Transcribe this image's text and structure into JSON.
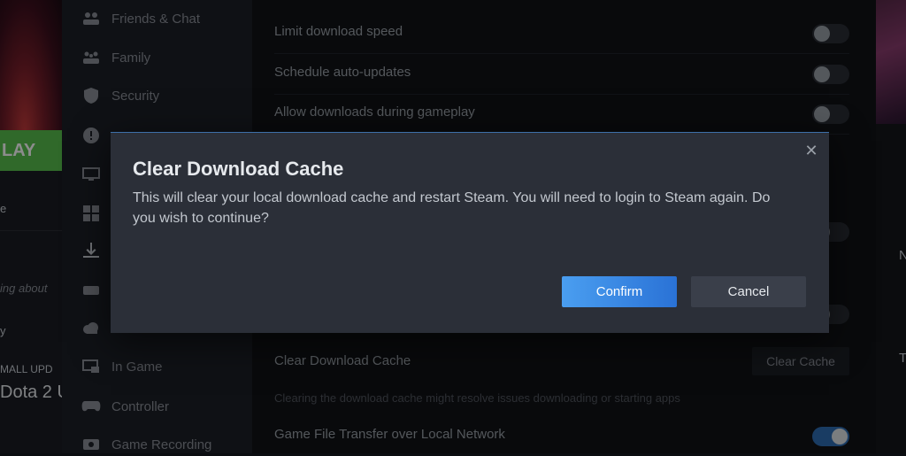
{
  "library": {
    "play_label": "LAY",
    "line1": "e",
    "news_snippet": "ing about",
    "line3": "y",
    "update_label": "MALL UPD",
    "game_title": "Dota 2 U"
  },
  "sidebar": {
    "items": [
      {
        "label": "Friends & Chat",
        "icon": "friends-icon"
      },
      {
        "label": "Family",
        "icon": "family-icon"
      },
      {
        "label": "Security",
        "icon": "shield-icon"
      },
      {
        "label": "",
        "icon": "info-icon"
      },
      {
        "label": "",
        "icon": "monitor-icon"
      },
      {
        "label": "",
        "icon": "grid-icon"
      },
      {
        "label": "",
        "icon": "download-icon"
      },
      {
        "label": "",
        "icon": "storage-icon"
      },
      {
        "label": "",
        "icon": "cloud-icon"
      },
      {
        "label": "In Game",
        "icon": "ingame-icon"
      },
      {
        "label": "Controller",
        "icon": "controller-icon"
      },
      {
        "label": "Game Recording",
        "icon": "recording-icon"
      }
    ]
  },
  "settings": {
    "limit_speed": "Limit download speed",
    "schedule_updates": "Schedule auto-updates",
    "allow_gameplay": "Allow downloads during gameplay",
    "clear_cache_label": "Clear Download Cache",
    "clear_cache_button": "Clear Cache",
    "clear_cache_help": "Clearing the download cache might resolve issues downloading or starting apps",
    "lan_transfer": "Game File Transfer over Local Network"
  },
  "right": {
    "letter1": "N",
    "letter2": "T"
  },
  "dialog": {
    "title": "Clear Download Cache",
    "body": "This will clear your local download cache and restart Steam. You will need to login to Steam again. Do you wish to continue?",
    "confirm_label": "Confirm",
    "cancel_label": "Cancel",
    "close_glyph": "✕"
  },
  "colors": {
    "accent": "#2a72d6",
    "play_green": "#58c04d",
    "dialog_bg": "#2b2f38"
  }
}
